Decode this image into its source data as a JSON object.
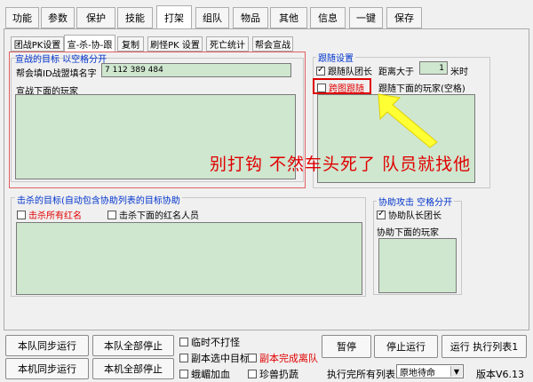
{
  "main_tabs": [
    "功能",
    "参数",
    "保护",
    "技能",
    "打架",
    "组队",
    "物品",
    "其他",
    "信息",
    "一键",
    "保存"
  ],
  "sub_tabs": [
    "团战PK设置",
    "宣-杀-协-跟",
    "复制",
    "刷怪PK 设置",
    "死亡统计",
    "帮会宣战"
  ],
  "declare": {
    "title": "宣战的目标  以空格分开",
    "id_label": "帮会填ID战盟填名字",
    "id_value": "7 112 389 484",
    "players_label": "宣战下面的玩家"
  },
  "follow": {
    "title": "跟随设置",
    "follow_leader": "跟随队团长",
    "distance_label": "距离大于",
    "distance_value": "1",
    "distance_unit": "米时",
    "cross_map": "跨图跟随",
    "players_label": "跟随下面的玩家(空格)"
  },
  "annotation": "别打钩  不然车头死了  队员就找他",
  "kill": {
    "title": "击杀的目标(自动包含协助列表的目标协助",
    "kill_all_red": "击杀所有红名",
    "kill_listed_red": "击杀下面的红名人员"
  },
  "assist": {
    "title": "协助攻击 空格分开",
    "assist_leader": "协助队长团长",
    "players_label": "协助下面的玩家"
  },
  "bottom": {
    "team_sync": "本队同步运行",
    "team_stop": "本队全部停止",
    "local_sync": "本机同步运行",
    "local_stop": "本机全部停止",
    "no_fight": "临时不打怪",
    "dungeon_select": "副本选中目标",
    "dungeon_done": "副本完成离队",
    "gecko_boost": "蛾嵋加血",
    "rare_beast": "珍兽扔蔬",
    "pause": "暂停",
    "stop_run": "停止运行",
    "run_list": "运行 执行列表1",
    "after_list_label": "执行完所有列表",
    "after_list_value": "原地待命",
    "version": "版本V6.13"
  },
  "colors": {
    "accent_red": "#e00000",
    "accent_blue": "#0033cc",
    "list_green": "#cfe6cf",
    "arrow_yellow": "#ffff33"
  }
}
